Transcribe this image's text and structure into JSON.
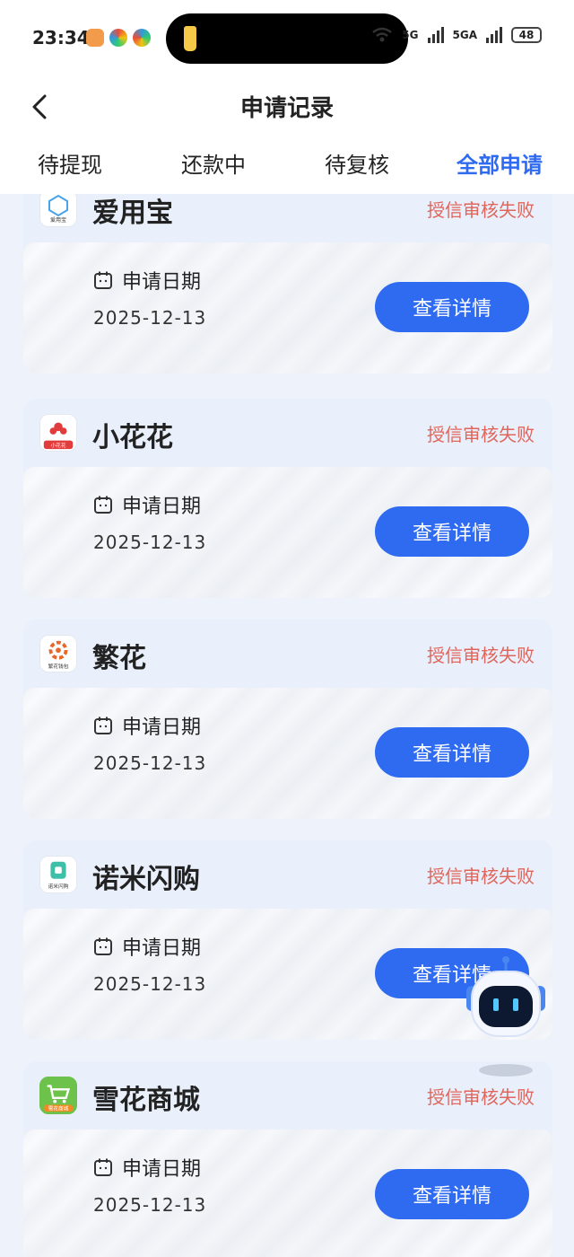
{
  "status_bar": {
    "time": "23:34",
    "battery": "48",
    "network_a": "5G",
    "network_b": "5GA"
  },
  "header": {
    "title": "申请记录"
  },
  "tabs": [
    {
      "label": "待提现",
      "active": false
    },
    {
      "label": "还款中",
      "active": false
    },
    {
      "label": "待复核",
      "active": false
    },
    {
      "label": "全部申请",
      "active": true
    }
  ],
  "cards": [
    {
      "app_name": "爱用宝",
      "logo_caption": "爱用宝",
      "status": "授信审核失败",
      "date_label": "申请日期",
      "date": "2025-12-13",
      "button": "查看详情"
    },
    {
      "app_name": "小花花",
      "logo_caption": "小花花",
      "status": "授信审核失败",
      "date_label": "申请日期",
      "date": "2025-12-13",
      "button": "查看详情"
    },
    {
      "app_name": "繁花",
      "logo_caption": "繁花钱包",
      "status": "授信审核失败",
      "date_label": "申请日期",
      "date": "2025-12-13",
      "button": "查看详情"
    },
    {
      "app_name": "诺米闪购",
      "logo_caption": "诺米闪购",
      "status": "授信审核失败",
      "date_label": "申请日期",
      "date": "2025-12-13",
      "button": "查看详情"
    },
    {
      "app_name": "雪花商城",
      "logo_caption": "雪花商城",
      "status": "授信审核失败",
      "date_label": "申请日期",
      "date": "2025-12-13",
      "button": "查看详情"
    }
  ],
  "colors": {
    "accent": "#2f6bf0",
    "status_fail": "#e0665c"
  }
}
